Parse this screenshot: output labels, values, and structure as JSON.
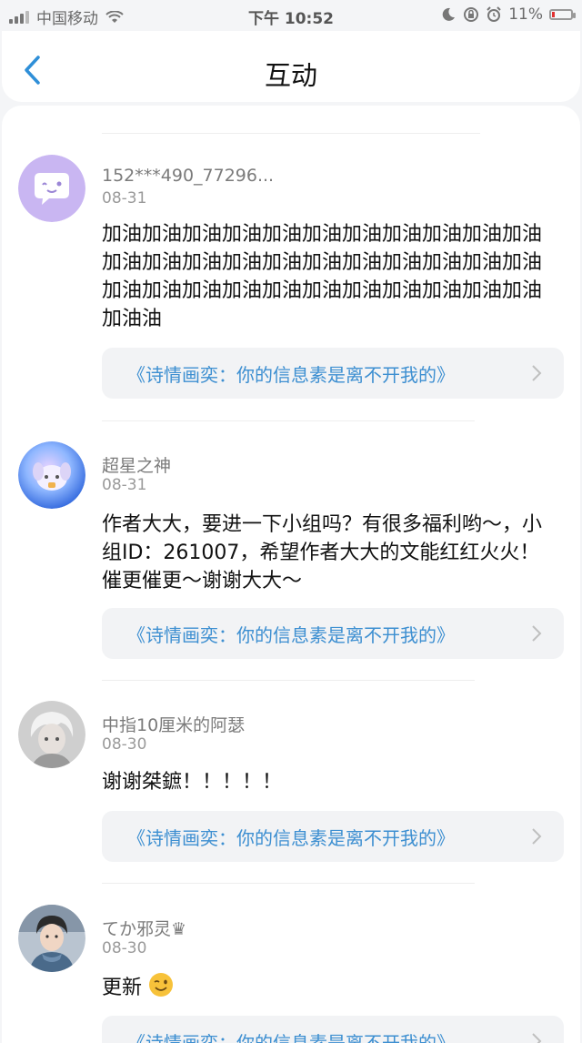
{
  "status_bar": {
    "carrier": "中国移动",
    "time": "下午 10:52",
    "battery_percent": "11%"
  },
  "header": {
    "title": "互动"
  },
  "comments": [
    {
      "username": "152***490_77296...",
      "date": "08-31",
      "text": "加油加油加油加油加油加油加油加油加油加油加油加油加油加油加油加油加油加油加油加油加油加油加油加油加油加油加油加油加油加油加油加油加油加油油",
      "book": "《诗情画奕：你的信息素是离不开我的》"
    },
    {
      "username": "超星之神",
      "date": "08-31",
      "text": "作者大大，要进一下小组吗？有很多福利哟～，小组ID：261007，希望作者大大的文能红红火火！催更催更～谢谢大大～",
      "book": "《诗情画奕：你的信息素是离不开我的》"
    },
    {
      "username": "中指10厘米的阿瑟",
      "date": "08-30",
      "text": "谢谢桀鏣！！！！！",
      "book": "《诗情画奕：你的信息素是离不开我的》"
    },
    {
      "username": "てか邪灵♛",
      "date": "08-30",
      "text": "更新",
      "book": "《诗情画奕：你的信息素是离不开我的》"
    }
  ],
  "colors": {
    "accent": "#3d8fd1",
    "background": "#f4f5f7"
  }
}
